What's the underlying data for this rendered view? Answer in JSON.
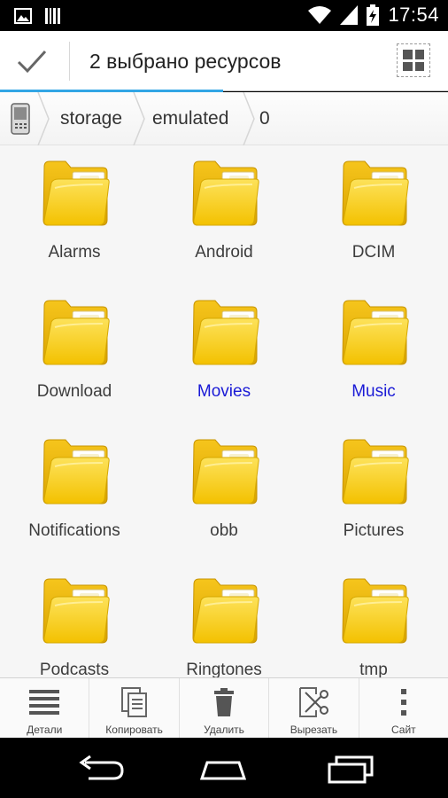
{
  "status_bar": {
    "time": "17:54",
    "left_icons": [
      "image-notification-icon",
      "barcode-notification-icon"
    ],
    "right_icons": [
      "wifi-icon",
      "signal-icon",
      "battery-charging-icon"
    ]
  },
  "action_bar": {
    "title": "2 выбрано ресурсов",
    "done_icon": "checkmark-icon",
    "view_toggle_icon": "grid-view-icon"
  },
  "breadcrumb": {
    "device_icon": "phone-device-icon",
    "items": [
      "storage",
      "emulated",
      "0"
    ]
  },
  "folders": [
    {
      "name": "Alarms",
      "selected": false
    },
    {
      "name": "Android",
      "selected": false
    },
    {
      "name": "DCIM",
      "selected": false
    },
    {
      "name": "Download",
      "selected": false
    },
    {
      "name": "Movies",
      "selected": true
    },
    {
      "name": "Music",
      "selected": true
    },
    {
      "name": "Notifications",
      "selected": false
    },
    {
      "name": "obb",
      "selected": false
    },
    {
      "name": "Pictures",
      "selected": false
    },
    {
      "name": "Podcasts",
      "selected": false
    },
    {
      "name": "Ringtones",
      "selected": false
    },
    {
      "name": "tmp",
      "selected": false
    }
  ],
  "toolbar": {
    "details": "Детали",
    "copy": "Копировать",
    "delete": "Удалить",
    "cut": "Вырезать",
    "site": "Сайт"
  },
  "colors": {
    "accent": "#33a6e5",
    "selected_label": "#1a1ad6",
    "folder_yellow": "#f7d22a"
  }
}
